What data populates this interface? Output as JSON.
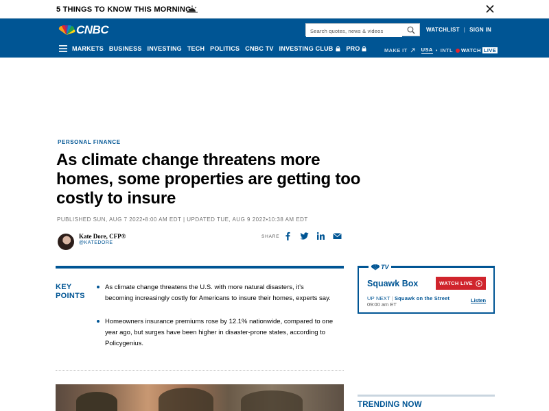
{
  "banner": {
    "text": "5 THINGS TO KNOW THIS MORNING",
    "icon": "sunrise-icon",
    "close_icon": "close-icon"
  },
  "header": {
    "logo_text": "CNBC",
    "search": {
      "placeholder": "Search quotes, news & videos"
    },
    "top_links": [
      "WATCHLIST",
      "SIGN IN"
    ],
    "nav_items": [
      "MARKETS",
      "BUSINESS",
      "INVESTING",
      "TECH",
      "POLITICS",
      "CNBC TV",
      "INVESTING CLUB",
      "PRO"
    ],
    "nav_right": {
      "make_it": "MAKE IT",
      "usa": "USA",
      "intl": "INTL",
      "watch": "WATCH",
      "live": "LIVE"
    }
  },
  "article": {
    "kicker": "PERSONAL FINANCE",
    "headline": "As climate change threatens more homes, some properties are getting too costly to insure",
    "published": "PUBLISHED SUN, AUG 7 2022•8:00 AM EDT | UPDATED TUE, AUG 9 2022•10:38 AM EDT",
    "author": {
      "name": "Kate Dore, CFP®",
      "handle": "@KATEDORE"
    },
    "share_label": "SHARE",
    "key_points_label": "KEY POINTS",
    "key_points": [
      "As climate change threatens the U.S. with more natural disasters, it’s becoming increasingly costly for Americans to insure their homes, experts say.",
      "Homeowners insurance premiums rose by 12.1% nationwide, compared to one year ago, but surges have been higher in disaster-prone states, according to Policygenius."
    ]
  },
  "sidebar": {
    "tv_logo": "TV",
    "show_title": "Squawk Box",
    "watch_live": "WATCH LIVE",
    "up_next_label": "UP NEXT",
    "up_next_show": "Squawk on the Street",
    "up_next_time": "09:00 am ET",
    "listen": "Listen",
    "trending": "TRENDING NOW"
  },
  "colors": {
    "brand_blue": "#005594",
    "live_red": "#d0242c",
    "text": "#000000",
    "meta_gray": "#747474"
  }
}
